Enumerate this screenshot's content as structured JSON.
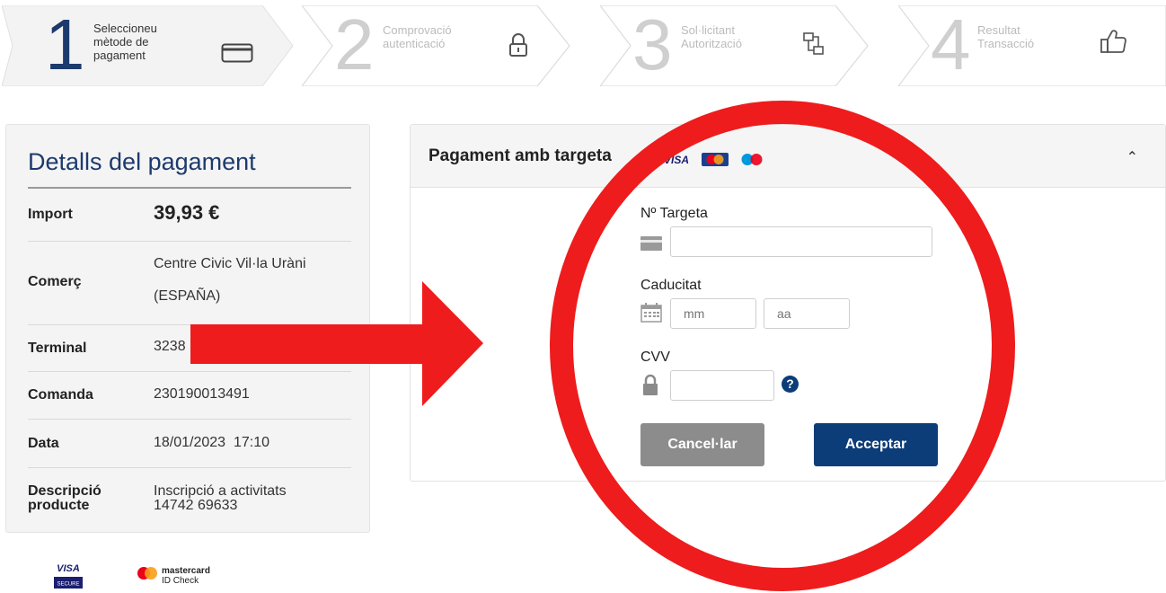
{
  "stepper": {
    "steps": [
      {
        "number": "1",
        "lines": [
          "Seleccioneu",
          "mètode de",
          "pagament"
        ],
        "icon": "credit-card-icon",
        "state": "active"
      },
      {
        "number": "2",
        "lines": [
          "Comprovació",
          "autenticació"
        ],
        "icon": "lock-icon",
        "state": "inactive"
      },
      {
        "number": "3",
        "lines": [
          "Sol·licitant",
          "Autorització"
        ],
        "icon": "network-icon",
        "state": "inactive"
      },
      {
        "number": "4",
        "lines": [
          "Resultat",
          "Transacció"
        ],
        "icon": "thumbs-up-icon",
        "state": "inactive"
      }
    ]
  },
  "details": {
    "title": "Detalls del pagament",
    "import_label": "Import",
    "import_value": "39,93 €",
    "merchant_label": "Comerç",
    "merchant_line1": "Centre Civic Vil·la Uràni",
    "merchant_line2": "(ESPAÑA)",
    "terminal_label": "Terminal",
    "terminal_value": "3238",
    "order_label": "Comanda",
    "order_value": "230190013491",
    "date_label": "Data",
    "date_value": "18/01/2023  17:10",
    "desc_label_line1": "Descripció",
    "desc_label_line2": "producte",
    "desc_value_line1": "Inscripció a activitats",
    "desc_value_line2": "14742 69633"
  },
  "payment": {
    "title": "Pagament amb targeta",
    "card_logos": [
      "VISA",
      "MasterCard",
      "Maestro"
    ],
    "card_number_label": "Nº Targeta",
    "card_number_value": "",
    "expiry_label": "Caducitat",
    "expiry_month_placeholder": "mm",
    "expiry_year_placeholder": "aa",
    "cvv_label": "CVV",
    "cvv_value": "",
    "help_symbol": "?",
    "cancel_label": "Cancel·lar",
    "accept_label": "Acceptar"
  },
  "footer": {
    "visa_secure_top": "VISA",
    "visa_secure_bottom": "SECURE",
    "mastercard_line1": "mastercard",
    "mastercard_line2": "ID Check"
  },
  "colors": {
    "primary": "#1d3a6d",
    "accept_button": "#0d3d78",
    "cancel_button": "#8c8c8c",
    "annotation_red": "#ee1c1c"
  }
}
